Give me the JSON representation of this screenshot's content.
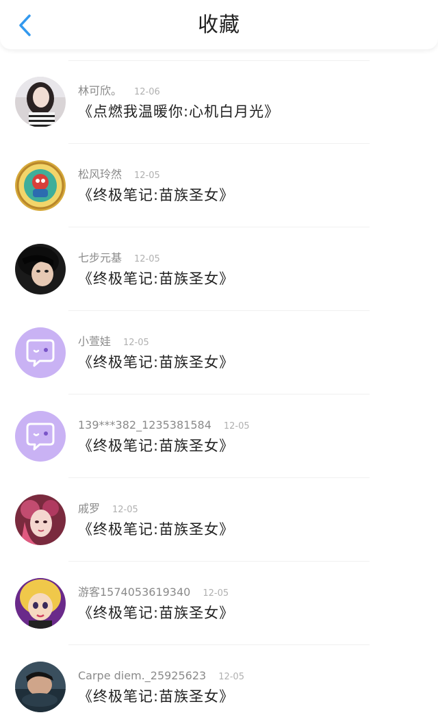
{
  "header": {
    "title": "收藏",
    "back_icon": "chevron-left-icon",
    "accent": "#3399ee"
  },
  "favorites": [
    {
      "user": "林可欣。",
      "date": "12-06",
      "title": "《点燃我温暖你:心机白月光》",
      "avatar": "photo-girl"
    },
    {
      "user": "松风玲然",
      "date": "12-05",
      "title": "《终极笔记:苗族圣女》",
      "avatar": "illustration-gold"
    },
    {
      "user": "七步元基",
      "date": "12-05",
      "title": "《终极笔记:苗族圣女》",
      "avatar": "photo-dark"
    },
    {
      "user": "小萱娃",
      "date": "12-05",
      "title": "《终极笔记:苗族圣女》",
      "avatar": "default-chat-purple"
    },
    {
      "user": "139***382_1235381584",
      "date": "12-05",
      "title": "《终极笔记:苗族圣女》",
      "avatar": "default-chat-purple"
    },
    {
      "user": "戚罗",
      "date": "12-05",
      "title": "《终极笔记:苗族圣女》",
      "avatar": "illustration-pink"
    },
    {
      "user": "游客1574053619340",
      "date": "12-05",
      "title": "《终极笔记:苗族圣女》",
      "avatar": "cartoon-blonde"
    },
    {
      "user": "Carpe diem._25925623",
      "date": "12-05",
      "title": "《终极笔记:苗族圣女》",
      "avatar": "photo-water"
    }
  ]
}
